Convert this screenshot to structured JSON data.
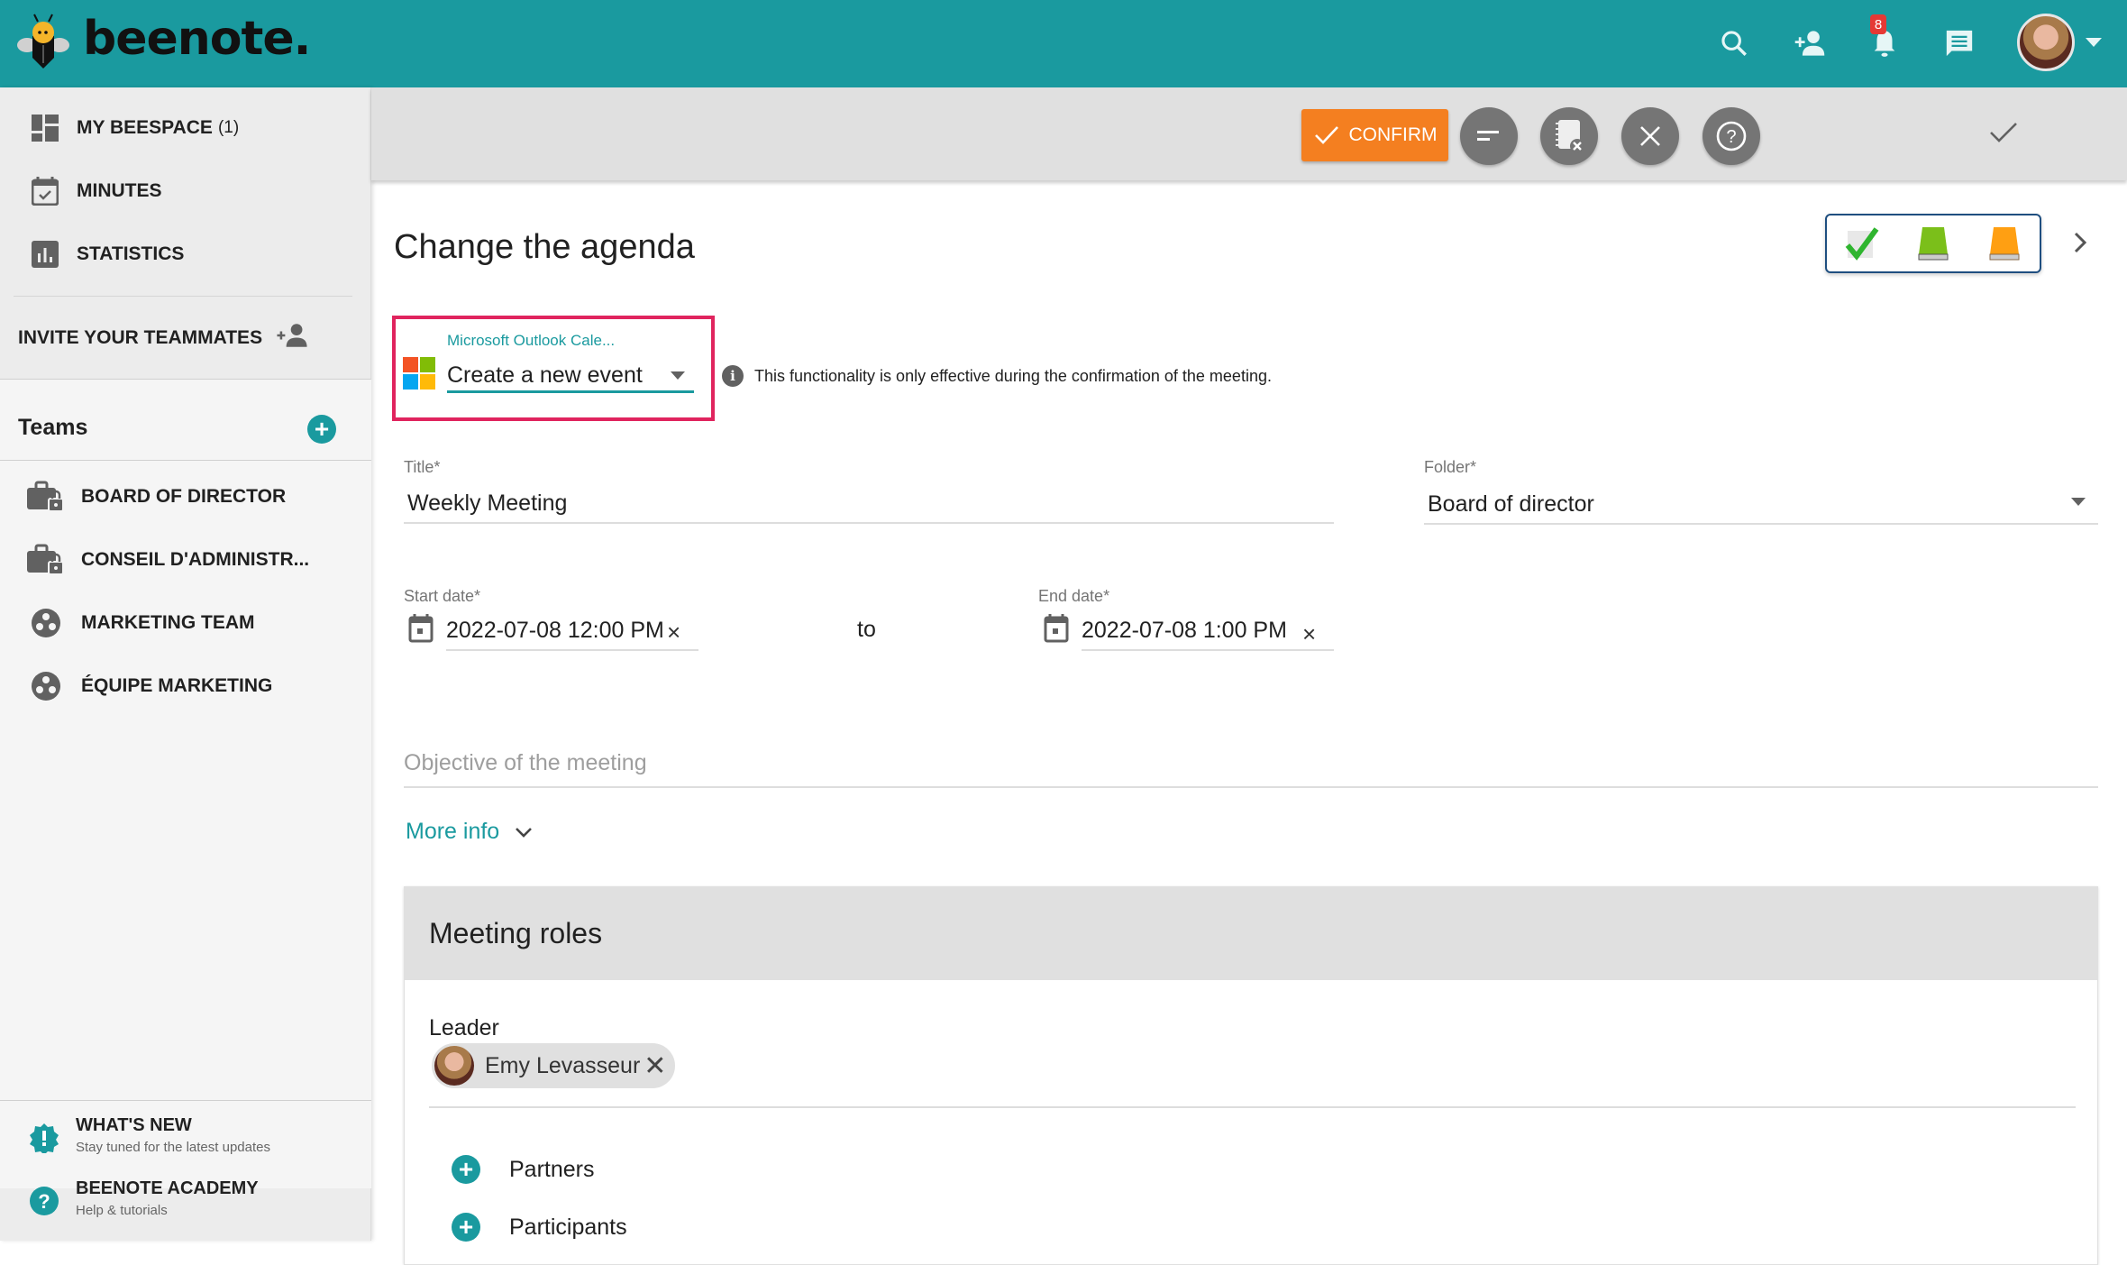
{
  "header": {
    "brand": "beenote.",
    "notification_count": "8",
    "icons": [
      "search-icon",
      "add-person-icon",
      "bell-icon",
      "chat-icon",
      "avatar",
      "caret-down-icon"
    ]
  },
  "sidebar": {
    "nav": [
      {
        "label": "MY BEESPACE",
        "count": "(1)",
        "icon": "dashboard-icon"
      },
      {
        "label": "MINUTES",
        "icon": "calendar-check-icon"
      },
      {
        "label": "STATISTICS",
        "icon": "bar-chart-icon"
      }
    ],
    "invite_label": "INVITE YOUR TEAMMATES",
    "teams_title": "Teams",
    "teams": [
      {
        "label": "BOARD OF DIRECTOR",
        "icon": "briefcase-lock-icon"
      },
      {
        "label": "CONSEIL D'ADMINISTR...",
        "icon": "briefcase-lock-icon"
      },
      {
        "label": "MARKETING TEAM",
        "icon": "group-circle-icon"
      },
      {
        "label": "ÉQUIPE MARKETING",
        "icon": "group-circle-icon"
      }
    ],
    "footer": [
      {
        "title": "WHAT'S NEW",
        "subtitle": "Stay tuned for the latest updates",
        "icon": "badge-alert-icon"
      },
      {
        "title": "BEENOTE ACADEMY",
        "subtitle": "Help & tutorials",
        "icon": "help-circle-icon"
      }
    ]
  },
  "toolbar": {
    "confirm_label": "CONFIRM",
    "buttons": [
      "sort-icon",
      "notebook-remove-icon",
      "close-icon",
      "help-icon"
    ]
  },
  "main": {
    "page_title": "Change the agenda",
    "status_icons": [
      "green-check-icon",
      "green-book-icon",
      "orange-book-icon"
    ],
    "outlook": {
      "label": "Microsoft Outlook Cale...",
      "value": "Create a new event",
      "info": "This functionality is only effective during the confirmation of the meeting."
    },
    "title_field": {
      "label": "Title",
      "required": "*",
      "value": "Weekly Meeting"
    },
    "folder_field": {
      "label": "Folder",
      "required": "*",
      "value": "Board of director"
    },
    "start_date": {
      "label": "Start date",
      "required": "*",
      "value": "2022-07-08 12:00 PM"
    },
    "to_label": "to",
    "end_date": {
      "label": "End date",
      "required": "*",
      "value": "2022-07-08 1:00 PM"
    },
    "objective_placeholder": "Objective of the meeting",
    "more_info_label": "More info",
    "roles": {
      "title": "Meeting roles",
      "leader_label": "Leader",
      "leader_name": "Emy Levasseur",
      "add_items": [
        "Partners",
        "Participants"
      ]
    }
  },
  "colors": {
    "brand": "#1a9a9f",
    "confirm": "#f47f20",
    "highlight": "#e0245e",
    "badge": "#e53935"
  }
}
